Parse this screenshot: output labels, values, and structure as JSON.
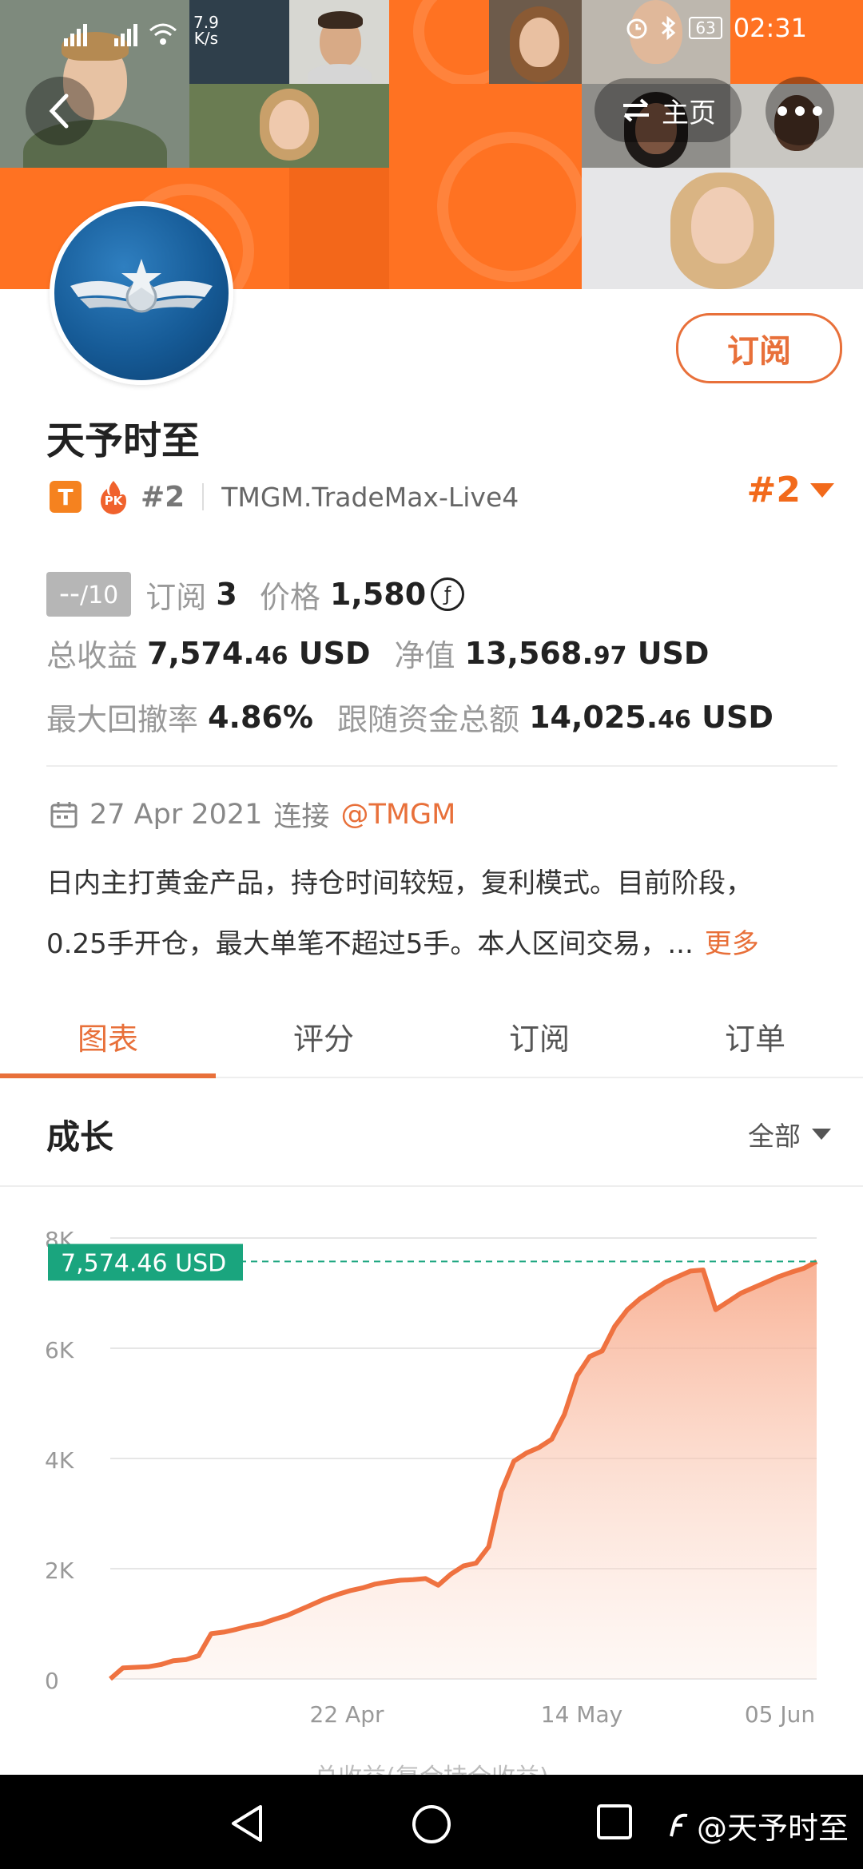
{
  "status_bar": {
    "net_speed_value": "7.9",
    "net_speed_unit": "K/s",
    "battery": "63",
    "time": "02:31"
  },
  "header": {
    "home_label": "主页"
  },
  "profile": {
    "name": "天予时至",
    "tag_letter": "T",
    "pk_label": "PK",
    "rank_small": "#2",
    "account": "TMGM.TradeMax-Live4",
    "rank_big": "#2",
    "subscribe_label": "订阅"
  },
  "stats": {
    "score": "--",
    "score_max": "/10",
    "subs_label": "订阅",
    "subs_value": "3",
    "price_label": "价格",
    "price_value": "1,580",
    "price_icon": "ƒ",
    "profit_label": "总收益",
    "profit_int": "7,574.",
    "profit_dec": "46",
    "profit_unit": "USD",
    "equity_label": "净值",
    "equity_int": "13,568.",
    "equity_dec": "97",
    "equity_unit": "USD",
    "drawdown_label": "最大回撤率",
    "drawdown_value": "4.86%",
    "follow_label": "跟随资金总额",
    "follow_int": "14,025.",
    "follow_dec": "46",
    "follow_unit": "USD"
  },
  "connect": {
    "date": "27 Apr 2021",
    "label": "连接",
    "mention": "@TMGM"
  },
  "description": {
    "line1": "日内主打黄金产品，持仓时间较短，复利模式。目前阶段，",
    "line2": "0.25手开仓，最大单笔不超过5手。本人区间交易，...",
    "more": "更多"
  },
  "tabs": [
    "图表",
    "评分",
    "订阅",
    "订单"
  ],
  "growth": {
    "title": "成长",
    "filter": "全部",
    "footer_cut": "总收益(复合持仓收益)"
  },
  "chart_data": {
    "type": "area",
    "ylim": [
      0,
      8000
    ],
    "yticks": [
      "0",
      "2K",
      "4K",
      "6K",
      "8K"
    ],
    "xticks": [
      "22 Apr",
      "14 May",
      "05 Jun"
    ],
    "current_label": "7,574.46 USD",
    "current_value": 7574.46,
    "line_color": "#ef7240",
    "marker_color": "#1aa57e",
    "values": [
      0,
      200,
      210,
      220,
      260,
      330,
      350,
      420,
      820,
      850,
      900,
      960,
      1000,
      1080,
      1150,
      1250,
      1350,
      1450,
      1530,
      1600,
      1650,
      1720,
      1760,
      1790,
      1800,
      1820,
      1700,
      1900,
      2050,
      2100,
      2400,
      3400,
      3950,
      4100,
      4200,
      4350,
      4800,
      5500,
      5850,
      5950,
      6400,
      6700,
      6900,
      7050,
      7200,
      7300,
      7400,
      7420,
      6700,
      6850,
      7000,
      7100,
      7200,
      7300,
      7380,
      7450,
      7574.46
    ]
  },
  "navbar": {
    "watermark": "@天予时至"
  }
}
